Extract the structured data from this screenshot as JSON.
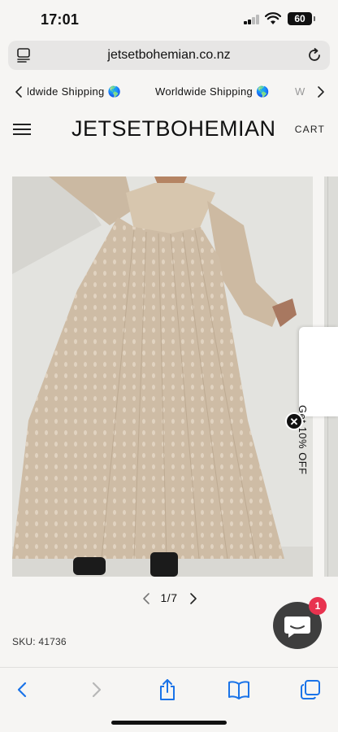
{
  "status": {
    "time": "17:01",
    "battery": "60"
  },
  "browser": {
    "url": "jetsetbohemian.co.nz"
  },
  "announcement": {
    "items": [
      "ldwide Shipping 🌎",
      "Worldwide Shipping 🌎",
      "W"
    ]
  },
  "header": {
    "logo": "JETSETBOHEMIAN",
    "cart_label": "CART"
  },
  "gallery": {
    "counter": "1/7"
  },
  "promo": {
    "label": "Get 10% OFF",
    "close_glyph": "✕"
  },
  "chat": {
    "badge_count": "1"
  },
  "product": {
    "sku": "SKU: 41736"
  }
}
